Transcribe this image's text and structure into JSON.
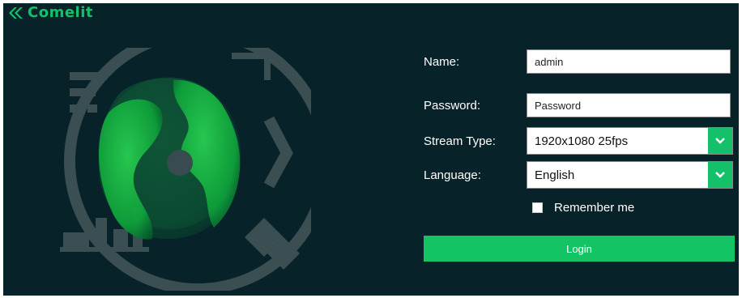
{
  "brand": {
    "logo_text": "Comelit",
    "accent": "#13c464",
    "background": "#08222a"
  },
  "login_form": {
    "name": {
      "label": "Name:",
      "value": "admin"
    },
    "password": {
      "label": "Password:",
      "placeholder": "Password"
    },
    "stream_type": {
      "label": "Stream Type:",
      "selected": "1920x1080 25fps"
    },
    "language": {
      "label": "Language:",
      "selected": "English"
    },
    "remember": {
      "label": "Remember me",
      "checked": false
    },
    "login_label": "Login"
  },
  "icons": [
    "comelit-logo-icon",
    "globe-illustration",
    "chevron-down-icon",
    "checkbox-icon"
  ]
}
